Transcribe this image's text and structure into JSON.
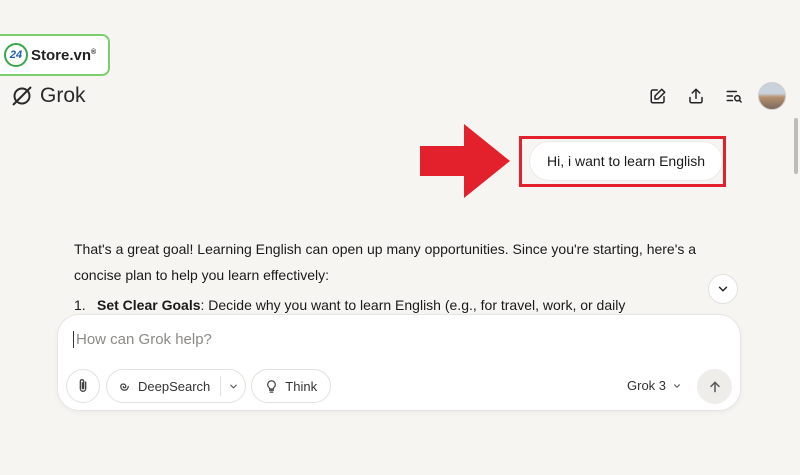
{
  "watermark": {
    "badge": "24",
    "text": "Store.vn",
    "reg": "®"
  },
  "header": {
    "brand": "Grok",
    "actions": [
      "edit-icon",
      "share-icon",
      "history-icon"
    ]
  },
  "chat": {
    "user_message": "Hi, i want to learn English",
    "response_intro": "That's a great goal! Learning English can open up many opportunities. Since you're starting, here's a concise plan to help you learn effectively:",
    "list": [
      {
        "num": "1.",
        "title": "Set Clear Goals",
        "text": ": Decide why you want to learn English (e.g., for travel, work, or daily"
      }
    ]
  },
  "composer": {
    "placeholder": "How can Grok help?",
    "deepsearch_label": "DeepSearch",
    "think_label": "Think",
    "model_label": "Grok 3"
  },
  "colors": {
    "highlight": "#e3212c",
    "background": "#f6f5f2"
  }
}
